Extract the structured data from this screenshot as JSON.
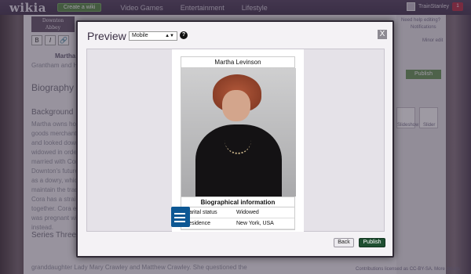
{
  "topbar": {
    "logo": "wikia",
    "create_wiki": "Create a wiki",
    "nav": [
      "Video Games",
      "Entertainment",
      "Lifestyle"
    ],
    "username": "TrainStanley",
    "notification_count": "1"
  },
  "article": {
    "logo_line1": "Downton",
    "logo_line2": "Abbey",
    "edit_tools": [
      "B",
      "I",
      "🔗"
    ],
    "title_snippet": "Martha L",
    "subtitle_snippet": "Grantham and H",
    "section_biography": "Biography",
    "section_background": "Background",
    "body_lines": [
      "Martha owns hou",
      "goods merchant",
      "and looked down",
      "widowed in order",
      "married with Cor",
      "Downton's future",
      "as a dowry, which",
      "maintain the trad",
      "Cora has a strain",
      "together. Cora ex",
      "was pregnant wi",
      "instead."
    ],
    "section_series_three": "Series Three",
    "bottom_line": "granddaughter Lady Mary Crawley and Matthew Crawley. She questioned the"
  },
  "rail": {
    "help_link": "Need help editing?",
    "notifications": "Notifications",
    "minor_edit": "Minor edit",
    "publish": "Publish",
    "thumb_label1": "Slideshow",
    "thumb_label2": "Slider",
    "license": "Contributions licensed as CC-BY-SA. More details"
  },
  "modal": {
    "title": "Preview",
    "mode_selected": "Mobile",
    "help_icon": "?",
    "close_icon": "X",
    "back": "Back",
    "publish": "Publish",
    "accent_color": "#1f4f31"
  },
  "infobox": {
    "title": "Martha Levinson",
    "section": "Biographical information",
    "rows": [
      {
        "label": "Marital status",
        "value": "Widowed"
      },
      {
        "label": "Residence",
        "value": "New York, USA"
      }
    ]
  }
}
